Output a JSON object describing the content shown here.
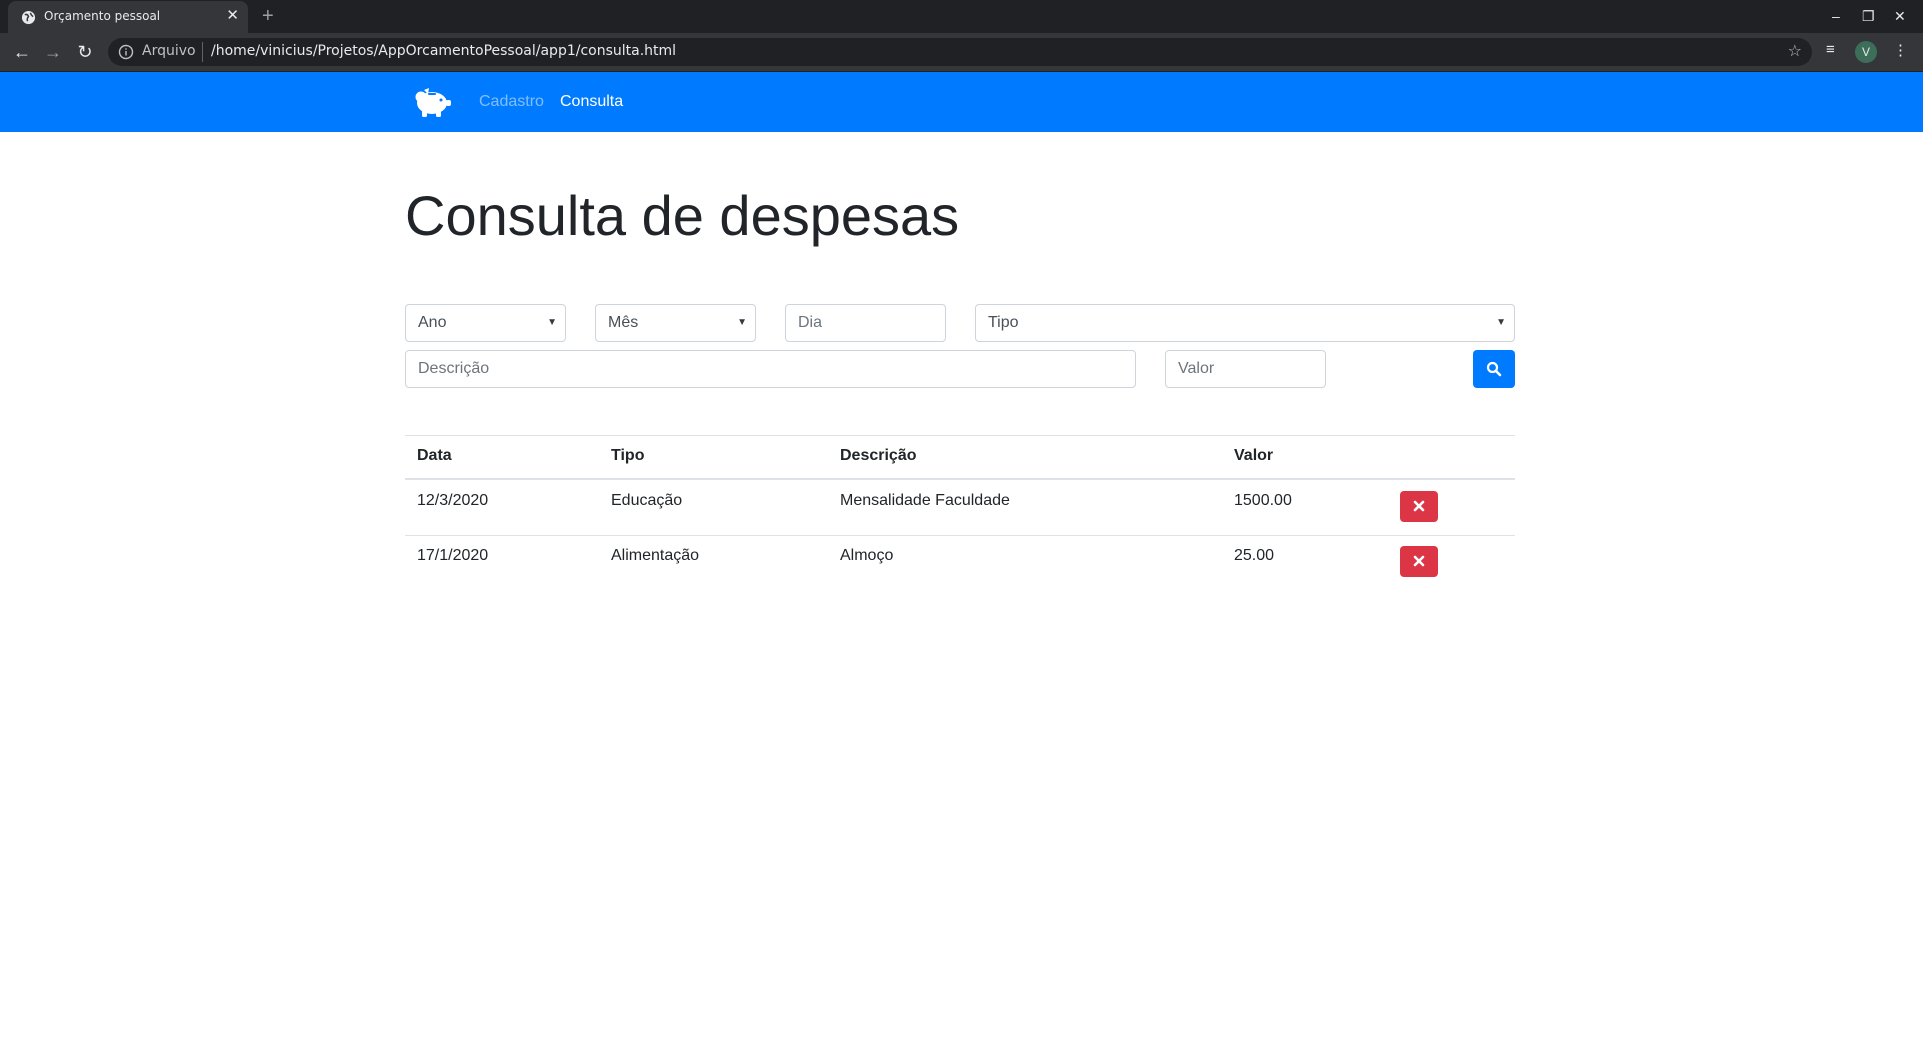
{
  "browser": {
    "tab_title": "Orçamento pessoal",
    "tab_close": "✕",
    "new_tab": "+",
    "scheme_label": "Arquivo",
    "url": "/home/vinicius/Projetos/AppOrcamentoPessoal/app1/consulta.html",
    "avatar_letter": "V"
  },
  "navbar": {
    "links": [
      {
        "label": "Cadastro"
      },
      {
        "label": "Consulta"
      }
    ]
  },
  "page": {
    "title": "Consulta de despesas"
  },
  "filters": {
    "ano": "Ano",
    "mes": "Mês",
    "dia_placeholder": "Dia",
    "tipo": "Tipo",
    "descricao_placeholder": "Descrição",
    "valor_placeholder": "Valor"
  },
  "table": {
    "headers": [
      "Data",
      "Tipo",
      "Descrição",
      "Valor"
    ],
    "rows": [
      {
        "data": "12/3/2020",
        "tipo": "Educação",
        "descricao": "Mensalidade Faculdade",
        "valor": "1500.00"
      },
      {
        "data": "17/1/2020",
        "tipo": "Alimentação",
        "descricao": "Almoço",
        "valor": "25.00"
      }
    ]
  },
  "colors": {
    "primary": "#007bff",
    "danger": "#dc3545",
    "browser_dark": "#202124"
  }
}
